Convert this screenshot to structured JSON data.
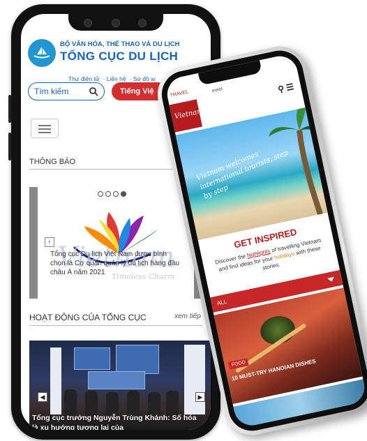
{
  "left_phone": {
    "header": {
      "ministry": "BỘ VĂN HÓA, THỂ THAO VÀ DU LỊCH",
      "agency": "TỔNG CỤC DU LỊCH"
    },
    "top_links": [
      "Thư điện tử",
      "Liên hệ",
      "Sơ đồ w"
    ],
    "search_placeholder": "Tìm kiếm",
    "language_button": "Tiếng Việ",
    "section_notice": "THÔNG BÁO",
    "slide": {
      "brand_word": "Vietnam",
      "brand_tagline": "Timeless Charm",
      "caption": "Tổng cục Du lịch Việt Nam được bình chọn là Cơ quan quản lý du lịch hàng đầu châu Á năm 2021",
      "active_dot": 4,
      "dot_count": 4,
      "prev_arrow": "‹"
    },
    "section_activity": "HOẠT ĐỘNG CỦA TỔNG CỤC",
    "see_more": "xem tiếp",
    "news": {
      "caption": "Tổng cục trưởng Nguyễn Trùng Khánh: Số hóa là xu hướng tương lai của",
      "prev_arrow": "◀",
      "next_arrow": "▶"
    }
  },
  "right_phone": {
    "top_bar": "TRAVEL",
    "top_bar_extra": "meet",
    "logo_text": "Vietnam",
    "hero_text": "Vietnam welcomes international tourists, step by step",
    "inspire": {
      "heading": "GET INSPIRED",
      "text_before": "Discover the ",
      "highlight_1": "highlights",
      "text_middle": " of travelling Vietnam and find ideas for your ",
      "highlight_2": "holidays",
      "text_after": " with these stories."
    },
    "filter_label": "ALL",
    "card": {
      "tag": "FOOD",
      "title": "10 MUST-TRY HANOIAN DISHES"
    }
  }
}
